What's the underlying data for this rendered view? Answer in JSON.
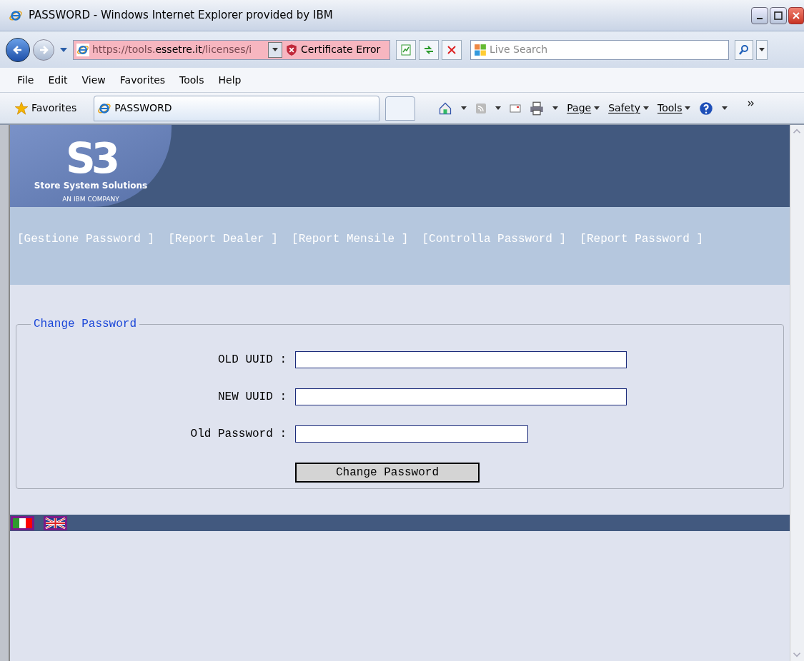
{
  "window": {
    "title": "PASSWORD - Windows Internet Explorer provided by IBM"
  },
  "address": {
    "prefix": "https://tools.",
    "domain": "essetre.it",
    "suffix": "/licenses/i",
    "security": "Certificate Error"
  },
  "search": {
    "placeholder": "Live Search"
  },
  "menu": [
    "File",
    "Edit",
    "View",
    "Favorites",
    "Tools",
    "Help"
  ],
  "favorites": {
    "label": "Favorites",
    "tab": "PASSWORD"
  },
  "command_bar": [
    "Page",
    "Safety",
    "Tools"
  ],
  "logo": {
    "mark": "S3",
    "name": "Store System Solutions",
    "tagline": "AN IBM COMPANY"
  },
  "nav": [
    "[Gestione Password ]",
    "[Report Dealer ]",
    "[Report Mensile ]",
    "[Controlla Password ]",
    "[Report Password ]"
  ],
  "form": {
    "legend": "Change Password",
    "fields": [
      {
        "label": "OLD UUID :",
        "kind": "uuid"
      },
      {
        "label": "NEW UUID :",
        "kind": "uuid"
      },
      {
        "label": "Old Password :",
        "kind": "password"
      }
    ],
    "submit": "Change Password"
  },
  "languages": [
    {
      "kind": "italian"
    },
    {
      "kind": "english"
    }
  ]
}
